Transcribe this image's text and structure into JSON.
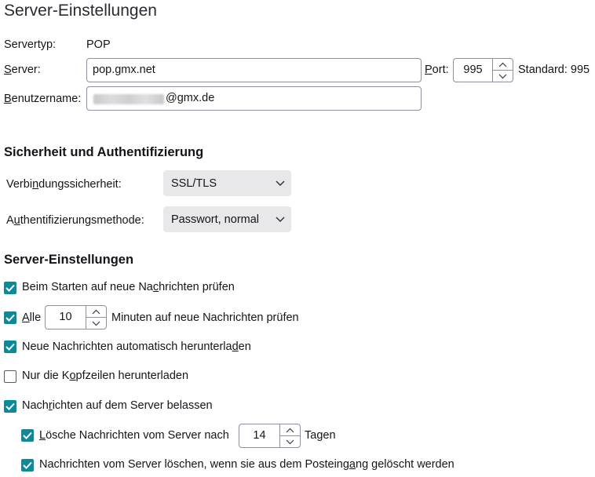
{
  "title": "Server-Einstellungen",
  "server": {
    "type_label": "Servertyp:",
    "type_value": "POP",
    "server_label_pre": "",
    "server_label_u": "S",
    "server_label_post": "erver:",
    "server_value": "pop.gmx.net",
    "port_label_u": "P",
    "port_label_post": "ort:",
    "port_value": "995",
    "standard_label": "Standard: 995",
    "user_label_u": "B",
    "user_label_post": "enutzername:",
    "user_value_suffix": "@gmx.de"
  },
  "security": {
    "heading": "Sicherheit und Authentifizierung",
    "conn_label_pre": "Verbi",
    "conn_label_u": "n",
    "conn_label_post": "dungssicherheit:",
    "conn_value": "SSL/TLS",
    "auth_label_pre": "A",
    "auth_label_u": "u",
    "auth_label_post": "thentifizierungsmethode:",
    "auth_value": "Passwort, normal"
  },
  "settings": {
    "heading": "Server-Einstellungen",
    "check_startup": {
      "checked": true,
      "pre": "Beim Starten auf neue Na",
      "u": "c",
      "post": "hrichten prüfen"
    },
    "check_every": {
      "checked": true,
      "pre": "",
      "u": "A",
      "post": "lle",
      "minutes": "10",
      "suffix": "Minuten auf neue Nachrichten prüfen"
    },
    "check_autodownload": {
      "checked": true,
      "pre": "Neue Nachrichten automatisch herunterla",
      "u": "d",
      "post": "en"
    },
    "check_headers": {
      "checked": false,
      "pre": "Nur die K",
      "u": "o",
      "post": "pfzeilen herunterladen"
    },
    "check_leave": {
      "checked": true,
      "pre": "Nach",
      "u": "r",
      "post": "ichten auf dem Server belassen"
    },
    "check_delete_after": {
      "checked": true,
      "pre": "",
      "u": "L",
      "post": "ösche Nachrichten vom Server nach",
      "days": "14",
      "suffix": "Tagen"
    },
    "check_delete_inbox": {
      "checked": true,
      "pre": "Nachrichten vom Server löschen, wenn sie aus dem Posteing",
      "u": "a",
      "post": "ng gelöscht werden"
    }
  }
}
